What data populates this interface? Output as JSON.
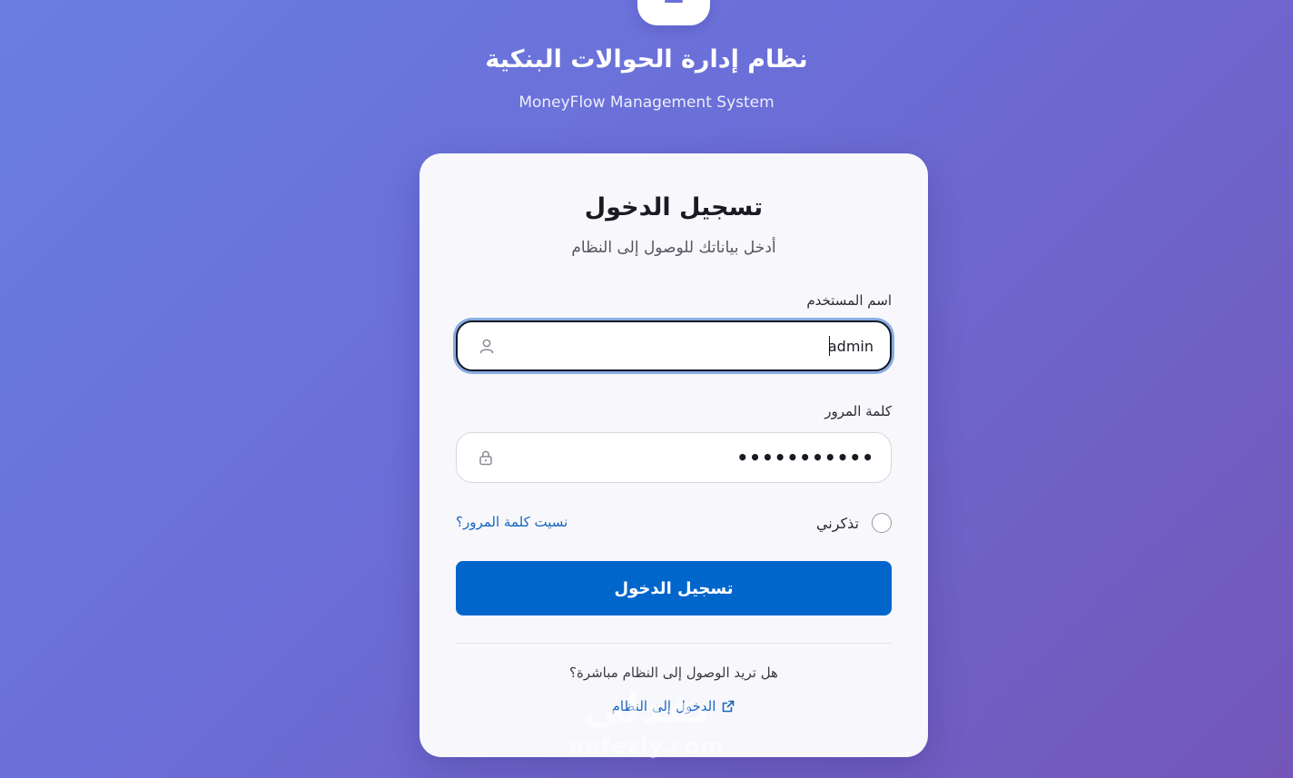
{
  "header": {
    "title": "نظام إدارة الحوالات البنكية",
    "subtitle": "MoneyFlow Management System"
  },
  "login_card": {
    "title": "تسجيل الدخول",
    "subtitle": "أدخل بياناتك للوصول إلى النظام",
    "username": {
      "label": "اسم المستخدم",
      "value": "admin",
      "icon": "user-icon"
    },
    "password": {
      "label": "كلمة المرور",
      "value": "•••••••••••",
      "icon": "lock-icon"
    },
    "remember_me": {
      "label": "تذكرني",
      "checked": false
    },
    "forgot_password": "نسيت كلمة المرور؟",
    "submit_label": "تسجيل الدخول",
    "direct_access": {
      "question": "هل تريد الوصول إلى النظام مباشرة؟",
      "link_label": "الدخول إلى النظام",
      "icon": "external-link-icon"
    }
  },
  "watermark": {
    "arabic": "نفذلي",
    "latin": "nafezly.com"
  },
  "colors": {
    "background_start": "#6a7ee0",
    "background_end": "#7356b8",
    "primary": "#0066cc",
    "link": "#1565c0",
    "card": "#f8f8fc"
  }
}
